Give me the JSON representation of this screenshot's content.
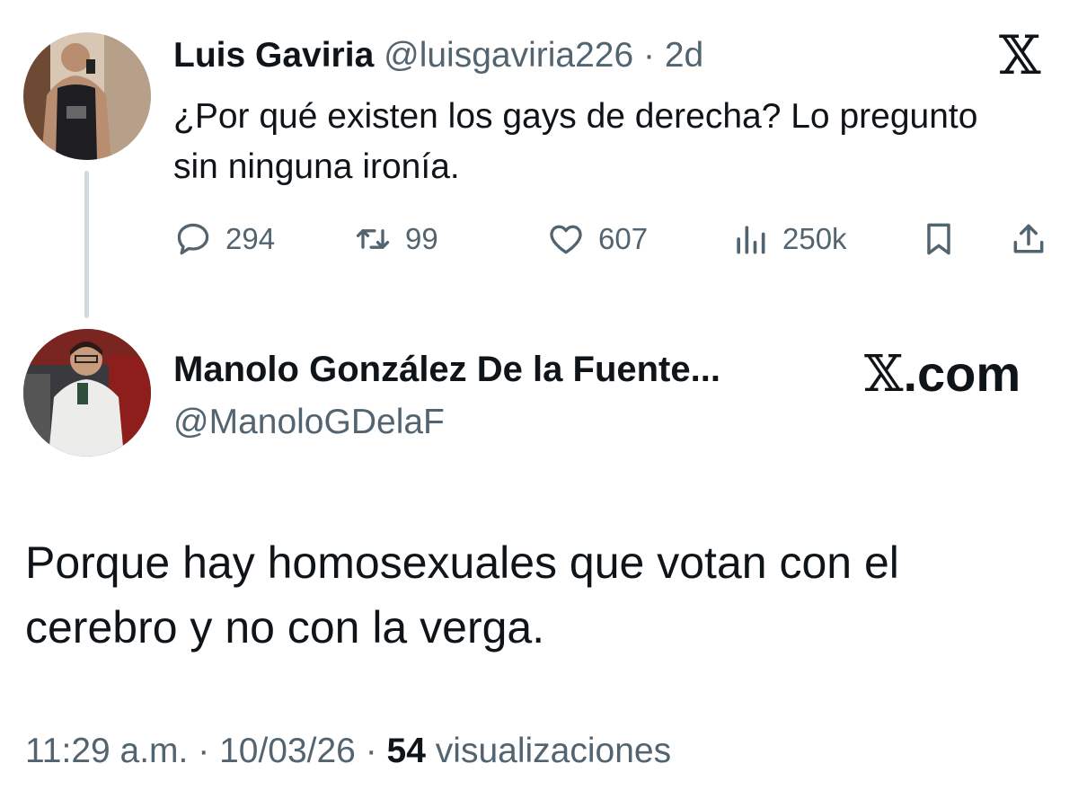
{
  "tweet1": {
    "name": "Luis Gaviria",
    "handle": "@luisgaviria226",
    "separator": " · ",
    "age": "2d",
    "text": "¿Por qué existen los gays de derecha? Lo pregunto sin ninguna ironía.",
    "avatar": "avatar-photo",
    "actions": {
      "replies": "294",
      "retweets": "99",
      "likes": "607",
      "views": "250k"
    },
    "icons": [
      "reply-icon",
      "retweet-icon",
      "like-icon",
      "views-icon",
      "bookmark-icon",
      "share-icon"
    ]
  },
  "brand": {
    "x_logo": "𝕏",
    "x_com_mark": "𝕏",
    "x_com_suffix": ".com"
  },
  "tweet2": {
    "name": "Manolo González De la Fuente...",
    "handle": "@ManoloGDelaF",
    "text": "Porque hay homosexuales que votan con el cerebro y no con la verga.",
    "avatar": "avatar-photo",
    "time": "11:29 a.m.",
    "sep1": " · ",
    "date": "10/03/26",
    "sep2": " · ",
    "view_count": "54",
    "view_label": " visualizaciones"
  },
  "colors": {
    "text": "#0f1419",
    "secondary": "#536471",
    "thread_line": "#cfd9de"
  }
}
